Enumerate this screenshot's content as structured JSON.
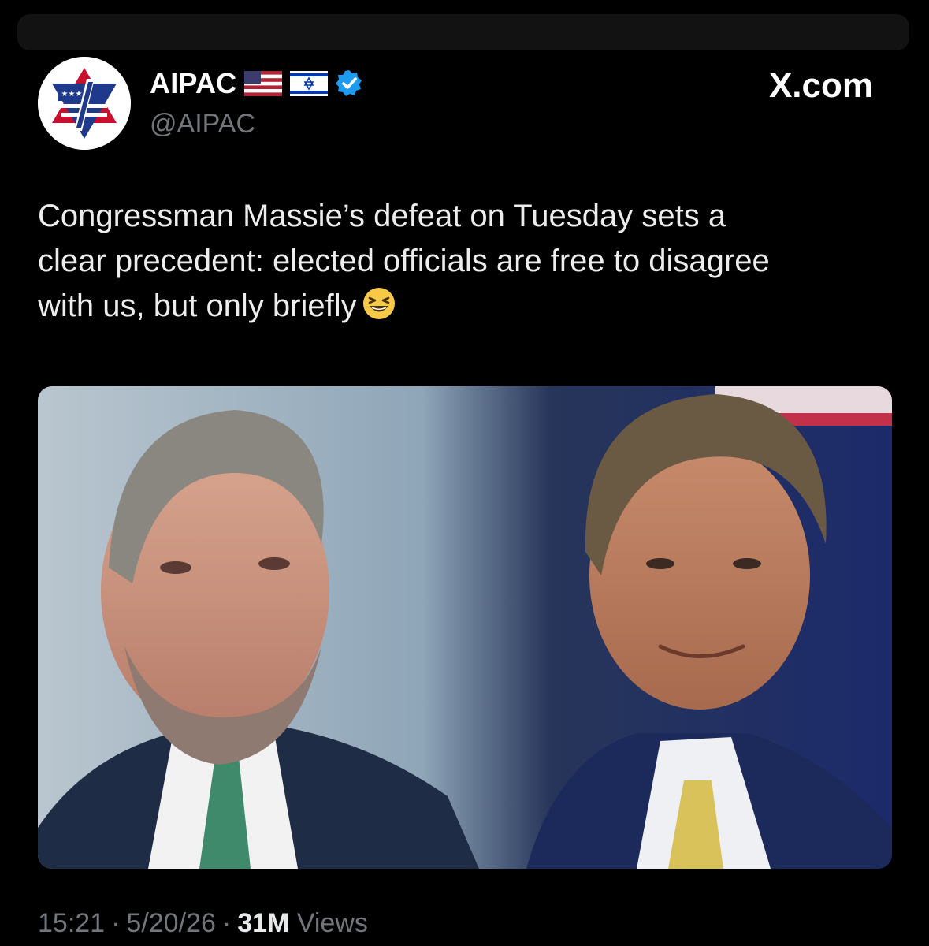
{
  "post": {
    "author": {
      "display_name": "AIPAC",
      "handle": "@AIPAC",
      "avatar_icon": "aipac-logo-icon",
      "badges": [
        "us-flag-icon",
        "israel-flag-icon",
        "verified-badge-icon"
      ],
      "verified_color": "#1d9bf0"
    },
    "site_label": "X.com",
    "text": {
      "line1": "Congressman Massie’s defeat on Tuesday sets a",
      "line2": "clear precedent: elected officials are free to disagree",
      "line3": "with us, but only briefly",
      "emoji": "grinning-squinting-face-emoji"
    },
    "media": {
      "image_icon": "two-portraits-photo"
    },
    "meta": {
      "time": "15:21",
      "separator": "·",
      "date": "5/20/26",
      "views_count": "31M",
      "views_label": "Views"
    }
  }
}
